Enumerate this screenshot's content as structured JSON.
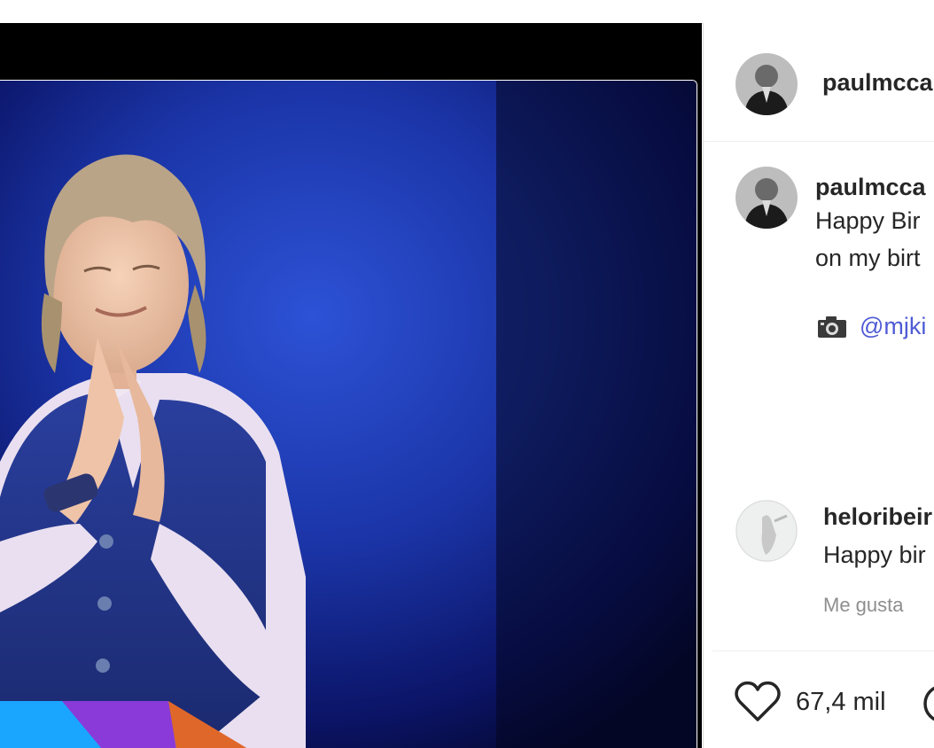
{
  "post": {
    "author": "paulmcca",
    "caption_author": "paulmcca",
    "caption_line1": "Happy Bir",
    "caption_line2": "on my birt",
    "credit_icon": "camera-icon",
    "credit_mention": "@mjki",
    "likes": "67,4 mil"
  },
  "comment": {
    "author": "heloribeir",
    "text": "Happy bir",
    "like_label": "Me gusta"
  },
  "colors": {
    "stage_blue": "#1a3fb0",
    "stage_dark": "#05082a",
    "mention": "#4f5bd5",
    "muted_text": "#8e8e8e"
  },
  "icons": [
    "heart-icon",
    "comment-icon",
    "camera-icon"
  ]
}
